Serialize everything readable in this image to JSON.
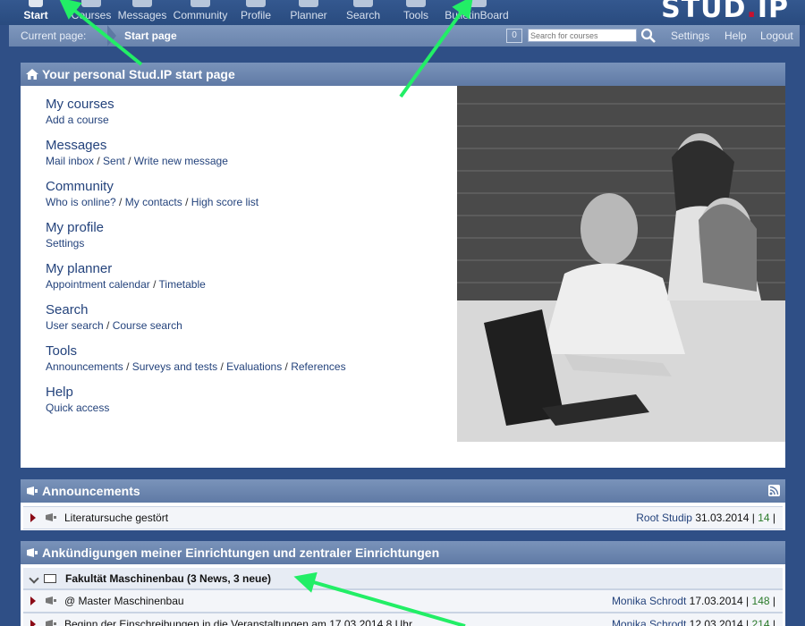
{
  "nav": {
    "items": [
      {
        "label": "Start",
        "icon": "home-icon"
      },
      {
        "label": "Courses",
        "icon": "courses-icon"
      },
      {
        "label": "Messages",
        "icon": "messages-icon"
      },
      {
        "label": "Community",
        "icon": "community-icon"
      },
      {
        "label": "Profile",
        "icon": "profile-icon"
      },
      {
        "label": "Planner",
        "icon": "planner-icon"
      },
      {
        "label": "Search",
        "icon": "search-icon"
      },
      {
        "label": "Tools",
        "icon": "tools-icon"
      },
      {
        "label": "BulletinBoard",
        "icon": "bulletinboard-icon"
      }
    ],
    "active_index": 0,
    "logo_text_a": "STUD",
    "logo_dot": ".",
    "logo_text_b": "IP"
  },
  "subbar": {
    "label": "Current page:",
    "current": "Start page",
    "message_count": "0",
    "search_placeholder": "Search for courses",
    "links": [
      "Settings",
      "Help",
      "Logout"
    ]
  },
  "start_panel": {
    "title": "Your personal Stud.IP start page",
    "sections": [
      {
        "title": "My courses",
        "links": [
          "Add a course"
        ]
      },
      {
        "title": "Messages",
        "links": [
          "Mail inbox",
          "Sent",
          "Write new message"
        ]
      },
      {
        "title": "Community",
        "links": [
          "Who is online?",
          "My contacts",
          "High score list"
        ]
      },
      {
        "title": "My profile",
        "links": [
          "Settings"
        ]
      },
      {
        "title": "My planner",
        "links": [
          "Appointment calendar",
          "Timetable"
        ]
      },
      {
        "title": "Search",
        "links": [
          "User search",
          "Course search"
        ]
      },
      {
        "title": "Tools",
        "links": [
          "Announcements",
          "Surveys and tests",
          "Evaluations",
          "References"
        ]
      },
      {
        "title": "Help",
        "links": [
          "Quick access"
        ]
      }
    ]
  },
  "announcements": {
    "title": "Announcements",
    "rows": [
      {
        "title": "Literatursuche gestört",
        "author": "Root Studip",
        "date": "31.03.2014",
        "count": "14"
      }
    ]
  },
  "institute_news": {
    "title": "Ankündigungen meiner Einrichtungen und zentraler Einrichtungen",
    "group": "Fakultät Maschinenbau (3 News, 3 neue)",
    "rows": [
      {
        "title": "@ Master Maschinenbau",
        "author": "Monika Schrodt",
        "date": "17.03.2014",
        "count": "148"
      },
      {
        "title": "Beginn der Einschreibungen in die Veranstaltungen am 17.03.2014 8 Uhr",
        "author": "Monika Schrodt",
        "date": "12.03.2014",
        "count": "214"
      }
    ]
  },
  "colors": {
    "nav_bg": "#2f5388",
    "accent_red": "#c8102e",
    "link": "#24437c",
    "annotation_arrow": "#22ee66"
  }
}
